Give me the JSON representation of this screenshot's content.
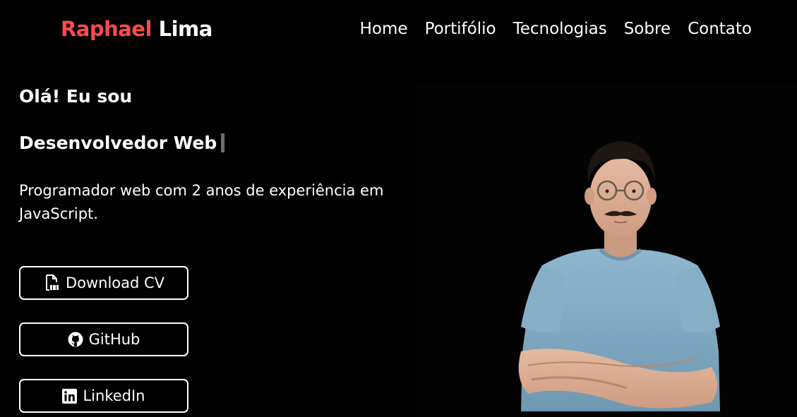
{
  "header": {
    "logo_first": "Raphael",
    "logo_last": "Lima",
    "nav": [
      "Home",
      "Portifólio",
      "Tecnologias",
      "Sobre",
      "Contato"
    ]
  },
  "hero": {
    "greeting": "Olá! Eu sou",
    "role": "Desenvolvedor Web",
    "description": "Programador web com 2 anos de experiência em JavaScript."
  },
  "buttons": {
    "cv": "Download CV",
    "github": "GitHub",
    "linkedin": "LinkedIn"
  },
  "icons": {
    "cv": "pdf-file-icon",
    "github": "github-icon",
    "linkedin": "linkedin-icon"
  },
  "colors": {
    "accent": "#ff4b4b",
    "background": "#000000",
    "text": "#ffffff"
  }
}
